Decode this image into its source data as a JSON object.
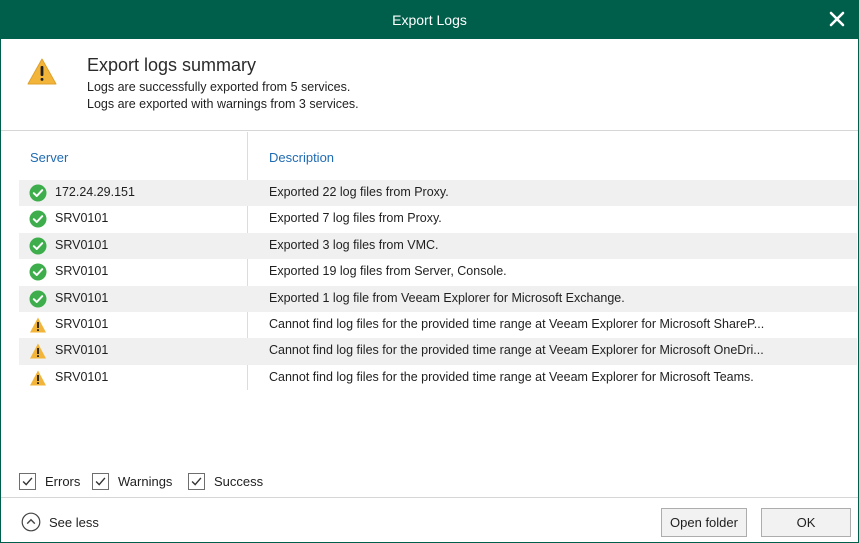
{
  "window": {
    "title": "Export Logs",
    "accent_color": "#005f4b",
    "close_icon": "close-icon"
  },
  "summary": {
    "icon": "warning-icon",
    "heading": "Export logs summary",
    "line1": "Logs are successfully exported from 5 services.",
    "line2": "Logs are exported with warnings from 3 services."
  },
  "table": {
    "columns": {
      "server": "Server",
      "description": "Description"
    },
    "rows": [
      {
        "status": "success",
        "server": "172.24.29.151",
        "description": "Exported 22 log files from Proxy."
      },
      {
        "status": "success",
        "server": "SRV0101",
        "description": "Exported 7 log files from Proxy."
      },
      {
        "status": "success",
        "server": "SRV0101",
        "description": "Exported 3 log files from VMC."
      },
      {
        "status": "success",
        "server": "SRV0101",
        "description": "Exported 19 log files from Server, Console."
      },
      {
        "status": "success",
        "server": "SRV0101",
        "description": "Exported 1 log file from Veeam Explorer for Microsoft Exchange."
      },
      {
        "status": "warning",
        "server": "SRV0101",
        "description": "Cannot find log files for the provided time range at Veeam Explorer for Microsoft ShareP..."
      },
      {
        "status": "warning",
        "server": "SRV0101",
        "description": "Cannot find log files for the provided time range at Veeam Explorer for Microsoft OneDri..."
      },
      {
        "status": "warning",
        "server": "SRV0101",
        "description": "Cannot find log files for the provided time range at Veeam Explorer for Microsoft Teams."
      }
    ]
  },
  "filters": {
    "errors": {
      "label": "Errors",
      "checked": true
    },
    "warnings": {
      "label": "Warnings",
      "checked": true
    },
    "success": {
      "label": "Success",
      "checked": true
    }
  },
  "footer": {
    "see_less": "See less",
    "open_folder": "Open folder",
    "ok": "OK"
  },
  "colors": {
    "success": "#3dae4b",
    "warning": "#f2b53a",
    "link": "#1f6bb3"
  }
}
